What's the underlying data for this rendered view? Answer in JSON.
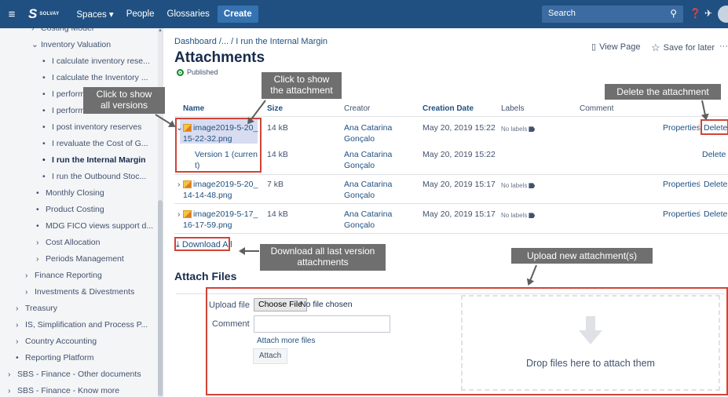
{
  "topbar": {
    "menu_icon": "≡",
    "brand": "SOLVAY",
    "nav": {
      "spaces": "Spaces ▾",
      "people": "People",
      "glossaries": "Glossaries",
      "create": "Create"
    },
    "search_placeholder": "Search"
  },
  "sidebar": {
    "items": [
      {
        "label": "Costing Model",
        "prefix": "›"
      },
      {
        "label": "Inventory Valuation",
        "prefix": "⌄"
      },
      {
        "label": "I calculate inventory rese...",
        "prefix": "•"
      },
      {
        "label": "I calculate the Inventory ...",
        "prefix": "•"
      },
      {
        "label": "I perform",
        "prefix": "•"
      },
      {
        "label": "I perform",
        "prefix": "•"
      },
      {
        "label": "I post inventory reserves",
        "prefix": "•"
      },
      {
        "label": "I revaluate the Cost of G...",
        "prefix": "•"
      },
      {
        "label": "I run the Internal Margin",
        "prefix": "•"
      },
      {
        "label": "I run the Outbound Stoc...",
        "prefix": "•"
      },
      {
        "label": "Monthly Closing",
        "prefix": "•"
      },
      {
        "label": "Product Costing",
        "prefix": "•"
      },
      {
        "label": "MDG FICO views support d...",
        "prefix": "•"
      },
      {
        "label": "Cost Allocation",
        "prefix": "›"
      },
      {
        "label": "Periods Management",
        "prefix": "›"
      },
      {
        "label": "Finance Reporting",
        "prefix": "›"
      },
      {
        "label": "Investments & Divestments",
        "prefix": "›"
      },
      {
        "label": "Treasury",
        "prefix": "›"
      },
      {
        "label": "IS, Simplification and Process P...",
        "prefix": "›"
      },
      {
        "label": "Country Accounting",
        "prefix": "›"
      },
      {
        "label": "Reporting Platform",
        "prefix": "•"
      },
      {
        "label": "SBS - Finance - Other documents",
        "prefix": "›"
      },
      {
        "label": "SBS - Finance - Know more",
        "prefix": "›"
      }
    ]
  },
  "breadcrumb": "Dashboard /... / I run the Internal Margin",
  "page_title": "Attachments",
  "status": "Published",
  "page_actions": {
    "view_page": "View Page",
    "save_for_later": "Save for later",
    "more": "···"
  },
  "table": {
    "headers": {
      "name": "Name",
      "size": "Size",
      "creator": "Creator",
      "date": "Creation Date",
      "labels": "Labels",
      "comment": "Comment"
    },
    "rows": [
      {
        "name_line1": "image2019-5-20_",
        "name_line2": "15-22-32.png",
        "size": "14 kB",
        "creator_line1": "Ana Catarina",
        "creator_line2": "Gonçalo",
        "date": "May 20, 2019 15:22",
        "labels": "No labels",
        "properties": "Properties",
        "delete": "Delete"
      },
      {
        "name_line1": "Version 1 (curren",
        "name_line2": "t)",
        "size": "14 kB",
        "creator_line1": "Ana Catarina",
        "creator_line2": "Gonçalo",
        "date": "May 20, 2019 15:22",
        "delete": "Delete"
      },
      {
        "name_line1": "image2019-5-20_",
        "name_line2": "14-14-48.png",
        "size": "7 kB",
        "creator_line1": "Ana Catarina",
        "creator_line2": "Gonçalo",
        "date": "May 20, 2019 15:17",
        "labels": "No labels",
        "properties": "Properties",
        "delete": "Delete"
      },
      {
        "name_line1": "image2019-5-17_",
        "name_line2": "16-17-59.png",
        "size": "14 kB",
        "creator_line1": "Ana Catarina",
        "creator_line2": "Gonçalo",
        "date": "May 20, 2019 15:17",
        "labels": "No labels",
        "properties": "Properties",
        "delete": "Delete"
      }
    ]
  },
  "download_all": "Download All",
  "attach_files": {
    "title": "Attach Files",
    "upload_label": "Upload file",
    "choose_file": "Choose File",
    "no_file": "No file chosen",
    "comment_label": "Comment",
    "attach_more": "Attach more files",
    "attach_button": "Attach",
    "drop_text": "Drop files here to attach them"
  },
  "callouts": {
    "show_versions_1": "Click to show",
    "show_versions_2": "all versions",
    "show_attachment_1": "Click to show",
    "show_attachment_2": "the attachment",
    "delete_attachment": "Delete the attachment",
    "download_all_1": "Download all last version",
    "download_all_2": "attachments",
    "upload_new": "Upload new attachment(s)"
  },
  "colors": {
    "topbar": "#205081",
    "link": "#205081",
    "annotation_red": "#d04437",
    "callout_gray": "#6f6f6f"
  }
}
